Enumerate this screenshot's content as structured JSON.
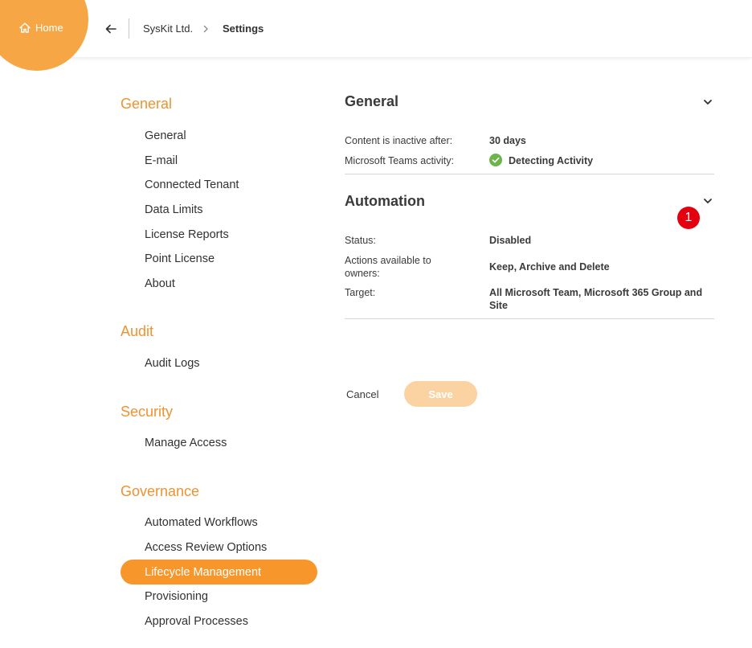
{
  "header": {
    "home_label": "Home",
    "breadcrumb": [
      "SysKit Ltd.",
      "Settings"
    ]
  },
  "sidebar": {
    "groups": [
      {
        "title": "General",
        "items": [
          "General",
          "E-mail",
          "Connected Tenant",
          "Data Limits",
          "License Reports",
          "Point License",
          "About"
        ]
      },
      {
        "title": "Audit",
        "items": [
          "Audit Logs"
        ]
      },
      {
        "title": "Security",
        "items": [
          "Manage Access"
        ]
      },
      {
        "title": "Governance",
        "items": [
          "Automated Workflows",
          "Access Review Options",
          "Lifecycle Management",
          "Provisioning",
          "Approval Processes"
        ]
      }
    ],
    "active_item": "Lifecycle Management"
  },
  "main": {
    "general": {
      "title": "General",
      "rows": [
        {
          "label": "Content is inactive after:",
          "value": "30 days"
        },
        {
          "label": "Microsoft Teams activity:",
          "value": "Detecting Activity"
        }
      ]
    },
    "automation": {
      "title": "Automation",
      "badge": "1",
      "rows": [
        {
          "label": "Status:",
          "value": "Disabled"
        },
        {
          "label": "Actions available to owners:",
          "value": "Keep, Archive and Delete"
        },
        {
          "label": "Target:",
          "value": "All Microsoft Team, Microsoft 365 Group and Site"
        }
      ]
    },
    "actions": {
      "cancel_label": "Cancel",
      "save_label": "Save"
    }
  },
  "colors": {
    "accent": "#f7962b",
    "group_title": "#f0922f",
    "success": "#6bb54a",
    "badge": "#e4000f",
    "save_disabled": "#fbd3a3"
  },
  "icons": {
    "home": "home-icon",
    "back": "arrow-left-icon",
    "crumb_separator": "chevron-right-icon",
    "collapse": "chevron-down-icon",
    "status": "check-circle-icon"
  }
}
